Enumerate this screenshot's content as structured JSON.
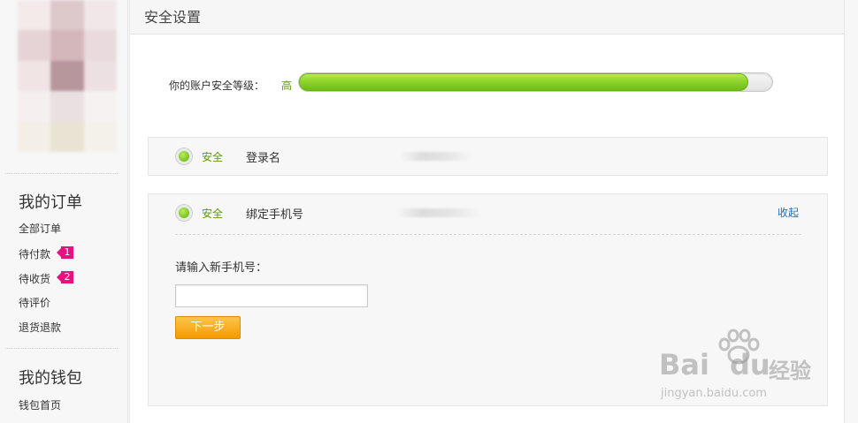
{
  "sidebar": {
    "sections": [
      {
        "title": "我的订单",
        "links": [
          {
            "label": "全部订单"
          },
          {
            "label": "待付款",
            "badge": "1"
          },
          {
            "label": "待收货",
            "badge": "2"
          },
          {
            "label": "待评价"
          },
          {
            "label": "退货退款"
          }
        ]
      },
      {
        "title": "我的钱包",
        "links": [
          {
            "label": "钱包首页"
          }
        ]
      }
    ]
  },
  "main": {
    "title": "安全设置",
    "security_level": {
      "label": "你的账户安全等级：",
      "value": "高",
      "progress": 0.95
    },
    "items": [
      {
        "status": "安全",
        "name": "登录名"
      },
      {
        "status": "安全",
        "name": "绑定手机号",
        "action": "收起",
        "form": {
          "label": "请输入新手机号：",
          "input_value": "",
          "button": "下一步"
        }
      }
    ]
  },
  "watermark": {
    "brand": "Bai",
    "brand2": "du",
    "product": "经验",
    "url": "jingyan.baidu.com"
  },
  "colors": {
    "accent_green": "#5b9a09",
    "badge_pink": "#e5137f",
    "button_orange": "#f59a00",
    "link_blue": "#2a6ab6"
  }
}
